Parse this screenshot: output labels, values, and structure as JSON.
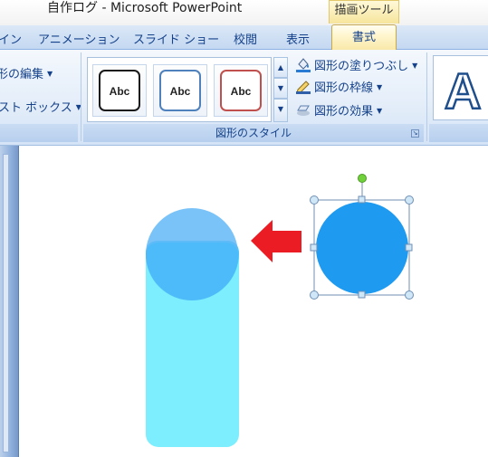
{
  "window": {
    "title": "自作ログ - Microsoft PowerPoint",
    "context_tab_group": "描画ツール"
  },
  "ribbon_tabs": [
    {
      "label": "イン"
    },
    {
      "label": "アニメーション"
    },
    {
      "label": "スライド ショー"
    },
    {
      "label": "校閲"
    },
    {
      "label": "表示"
    },
    {
      "label": "書式",
      "active": true
    }
  ],
  "ribbon": {
    "left_group": {
      "edit_shape_label": "形の編集",
      "text_box_label": "スト ボックス"
    },
    "shape_styles": {
      "group_label": "図形のスタイル",
      "thumbnails": [
        {
          "label": "Abc",
          "border_color": "#1a1a1a"
        },
        {
          "label": "Abc",
          "border_color": "#4f81bd"
        },
        {
          "label": "Abc",
          "border_color": "#c0504d"
        }
      ],
      "fill_label": "図形の塗りつぶし",
      "outline_label": "図形の枠線",
      "effects_label": "図形の効果"
    },
    "wordart_preview": "A"
  },
  "colors": {
    "arrow": "#ec1c24",
    "selected_circle": "#1e9bf0",
    "rounded_bar": "#7ceefd",
    "bar_top": "#45c5fb",
    "overlap_circle": "#63b9f7",
    "selection_handle": "#9dd7f5",
    "rotation_handle": "#71d13b"
  }
}
